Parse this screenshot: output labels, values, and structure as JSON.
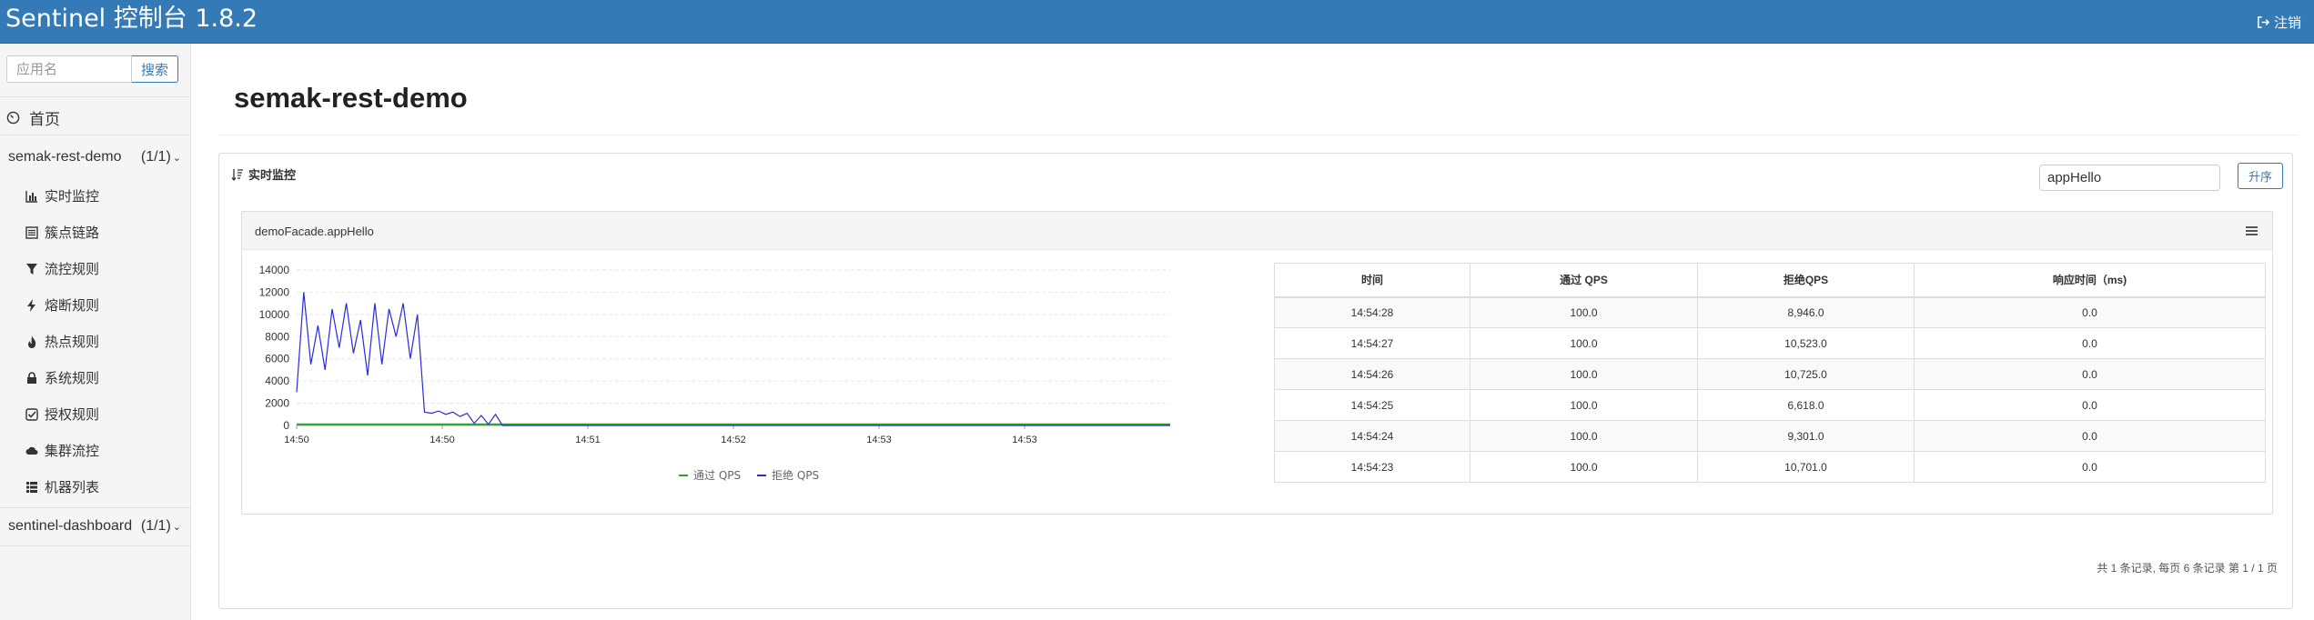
{
  "header": {
    "title": "Sentinel 控制台 1.8.2",
    "logout_label": "注销"
  },
  "sidebar": {
    "search_placeholder": "应用名",
    "search_button": "搜索",
    "home_label": "首页",
    "apps": [
      {
        "name": "semak-rest-demo",
        "count": "(1/1)",
        "expanded": true,
        "menu": [
          {
            "label": "实时监控",
            "icon": "bar-chart-icon"
          },
          {
            "label": "簇点链路",
            "icon": "list-icon"
          },
          {
            "label": "流控规则",
            "icon": "filter-icon"
          },
          {
            "label": "熔断规则",
            "icon": "flash-icon"
          },
          {
            "label": "热点规则",
            "icon": "fire-icon"
          },
          {
            "label": "系统规则",
            "icon": "lock-icon"
          },
          {
            "label": "授权规则",
            "icon": "check-icon"
          },
          {
            "label": "集群流控",
            "icon": "cloud-icon"
          },
          {
            "label": "机器列表",
            "icon": "th-list-icon"
          }
        ]
      },
      {
        "name": "sentinel-dashboard",
        "count": "(1/1)",
        "expanded": false
      }
    ]
  },
  "main": {
    "app_title": "semak-rest-demo",
    "panel_title": "实时监控",
    "resource_value": "appHello",
    "sort_button": "升序",
    "card": {
      "title": "demoFacade.appHello",
      "table": {
        "headers": [
          "时间",
          "通过 QPS",
          "拒绝QPS",
          "响应时间（ms)"
        ],
        "rows": [
          [
            "14:54:28",
            "100.0",
            "8,946.0",
            "0.0"
          ],
          [
            "14:54:27",
            "100.0",
            "10,523.0",
            "0.0"
          ],
          [
            "14:54:26",
            "100.0",
            "10,725.0",
            "0.0"
          ],
          [
            "14:54:25",
            "100.0",
            "6,618.0",
            "0.0"
          ],
          [
            "14:54:24",
            "100.0",
            "9,301.0",
            "0.0"
          ],
          [
            "14:54:23",
            "100.0",
            "10,701.0",
            "0.0"
          ]
        ]
      }
    },
    "pagination": "共 1 条记录, 每页 6 条记录 第 1 / 1 页"
  },
  "colors": {
    "header": "#337ab7",
    "pass_series": "#2da32d",
    "block_series": "#2a2adf"
  },
  "chart_data": {
    "type": "line",
    "title": "",
    "xlabel": "",
    "ylabel": "",
    "ylim": [
      0,
      14000
    ],
    "yticks": [
      "14000",
      "12000",
      "10000",
      "8000",
      "6000",
      "4000",
      "2000",
      "0"
    ],
    "xticks": [
      "14:50",
      "14:50",
      "14:51",
      "14:52",
      "14:53",
      "14:53"
    ],
    "legend": "bottom",
    "grid": true,
    "series": [
      {
        "name": "通过 QPS",
        "color": "#2da32d",
        "values": [
          100,
          100,
          100,
          100,
          100,
          100,
          100,
          100,
          100,
          100,
          100,
          100,
          100,
          100,
          100,
          100,
          100,
          100,
          100,
          100,
          100,
          100,
          100,
          100,
          100,
          100,
          100,
          100,
          100,
          100,
          100,
          100,
          100,
          100,
          100,
          100,
          100,
          100,
          100,
          100,
          100,
          100,
          100,
          100,
          100,
          100,
          100,
          100,
          100,
          100,
          100,
          100,
          100,
          100,
          100,
          100,
          100,
          100,
          100,
          100,
          100,
          100,
          100,
          100,
          100,
          100,
          100,
          100,
          100,
          100,
          100,
          100,
          100,
          100,
          100,
          100,
          100,
          100,
          100,
          100,
          100,
          100,
          100,
          100,
          100,
          100,
          100,
          100,
          100,
          100,
          100,
          100,
          100,
          100,
          100,
          100,
          100,
          100,
          100,
          100,
          100,
          100,
          100,
          100,
          100,
          100,
          100,
          100,
          100,
          100,
          100,
          100,
          100,
          100,
          100,
          100,
          100,
          100,
          100,
          100
        ]
      },
      {
        "name": "拒绝 QPS",
        "color": "#2a2adf",
        "values": [
          3000,
          12000,
          5500,
          9000,
          5000,
          10500,
          7000,
          11000,
          6500,
          9500,
          4500,
          11000,
          5500,
          10500,
          8000,
          11000,
          6000,
          10000,
          1200,
          1100,
          1300,
          1000,
          1200,
          800,
          1100,
          200,
          900,
          100,
          1000,
          0,
          0,
          0,
          0,
          0,
          0,
          0,
          0,
          0,
          0,
          0,
          0,
          0,
          0,
          0,
          0,
          0,
          0,
          0,
          0,
          0,
          0,
          0,
          0,
          0,
          0,
          0,
          0,
          0,
          0,
          0,
          0,
          0,
          0,
          0,
          0,
          0,
          0,
          0,
          0,
          0,
          0,
          0,
          0,
          0,
          0,
          0,
          0,
          0,
          0,
          0,
          0,
          0,
          0,
          0,
          0,
          0,
          0,
          0,
          0,
          0,
          0,
          0,
          0,
          0,
          0,
          0,
          0,
          0,
          0,
          0,
          0,
          0,
          0,
          0,
          0,
          0,
          0,
          0,
          0,
          0,
          0,
          0,
          0,
          0,
          0,
          0,
          0,
          0,
          0,
          0,
          0,
          0,
          0,
          0
        ]
      }
    ]
  }
}
